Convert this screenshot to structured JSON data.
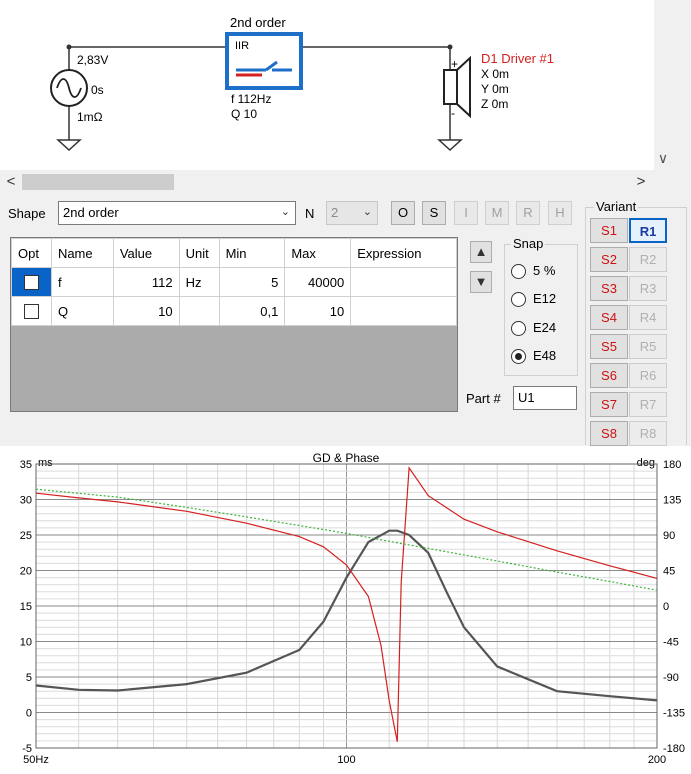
{
  "schematic": {
    "block_title": "2nd order",
    "block_type": "IIR",
    "block_param_f": "f  112Hz",
    "block_param_q": "Q  10",
    "source_voltage": "2,83V",
    "source_delay": "0s",
    "source_impedance": "1mΩ",
    "driver_name": "D1 Driver #1",
    "driver_x": "X 0m",
    "driver_y": "Y 0m",
    "driver_z": "Z 0m",
    "plus": "+",
    "minus": "-"
  },
  "scroll": {
    "left": "<",
    "right": ">",
    "down": "∨"
  },
  "shape": {
    "label": "Shape",
    "value": "2nd order",
    "n_label": "N",
    "n_value": "2",
    "buttons": [
      "O",
      "S",
      "I",
      "M",
      "R",
      "H"
    ]
  },
  "grid": {
    "columns": [
      "Opt",
      "Name",
      "Value",
      "Unit",
      "Min",
      "Max",
      "Expression"
    ],
    "rows": [
      {
        "name": "f",
        "value": "112",
        "unit": "Hz",
        "min": "5",
        "max": "40000",
        "expression": ""
      },
      {
        "name": "Q",
        "value": "10",
        "unit": "",
        "min": "0,1",
        "max": "10",
        "expression": ""
      }
    ]
  },
  "snap": {
    "title": "Snap",
    "options": [
      "5 %",
      "E12",
      "E24",
      "E48"
    ],
    "selected": "E48"
  },
  "part": {
    "label": "Part #",
    "value": "U1"
  },
  "variant": {
    "title": "Variant",
    "s_buttons": [
      "S1",
      "S2",
      "S3",
      "S4",
      "S5",
      "S6",
      "S7",
      "S8"
    ],
    "r_buttons": [
      "R1",
      "R2",
      "R3",
      "R4",
      "R5",
      "R6",
      "R7",
      "R8"
    ],
    "active": "R1"
  },
  "chart_data": {
    "type": "line",
    "title": "GD & Phase",
    "y_left_unit": "ms",
    "y_right_unit": "deg",
    "x_scale": "log",
    "xlim": [
      50,
      200
    ],
    "ylim_left": [
      -5,
      35
    ],
    "ylim_right": [
      -180,
      180
    ],
    "x_tick_labels": [
      "50Hz",
      "100",
      "200"
    ],
    "y_left_ticks": [
      "35",
      "30",
      "25",
      "20",
      "15",
      "10",
      "5",
      "0",
      "-5"
    ],
    "y_right_ticks": [
      "180",
      "135",
      "90",
      "45",
      "0",
      "-45",
      "-90",
      "-135",
      "-180"
    ],
    "grid": true,
    "series": [
      {
        "axis": "left",
        "color": "#555555",
        "style": "solid",
        "x": [
          50,
          55,
          60,
          70,
          80,
          90,
          95,
          100,
          105,
          110,
          112,
          115,
          120,
          125,
          130,
          140,
          160,
          180,
          200
        ],
        "y": [
          3.8,
          3.2,
          3.1,
          4.0,
          5.6,
          8.8,
          12.8,
          19.0,
          24.0,
          25.6,
          25.6,
          25.0,
          22.5,
          17.0,
          12.0,
          6.5,
          3.0,
          2.3,
          1.7
        ]
      },
      {
        "axis": "right",
        "color": "#d42020",
        "style": "solid",
        "x": [
          50,
          55,
          60,
          70,
          80,
          90,
          95,
          100,
          105,
          108,
          110,
          112,
          113,
          115,
          120,
          130,
          140,
          160,
          180,
          200
        ],
        "y": [
          143,
          137,
          132,
          120,
          105,
          88,
          75,
          52,
          12,
          -50,
          -120,
          -172,
          30,
          175,
          140,
          110,
          94,
          70,
          51,
          35
        ]
      },
      {
        "axis": "right",
        "color": "#3cb43c",
        "style": "dashed",
        "x": [
          50,
          60,
          70,
          80,
          90,
          100,
          110,
          120,
          140,
          160,
          180,
          200
        ],
        "y": [
          148,
          138,
          125,
          113,
          102,
          92,
          82,
          73,
          57,
          43,
          31,
          20
        ]
      }
    ]
  }
}
